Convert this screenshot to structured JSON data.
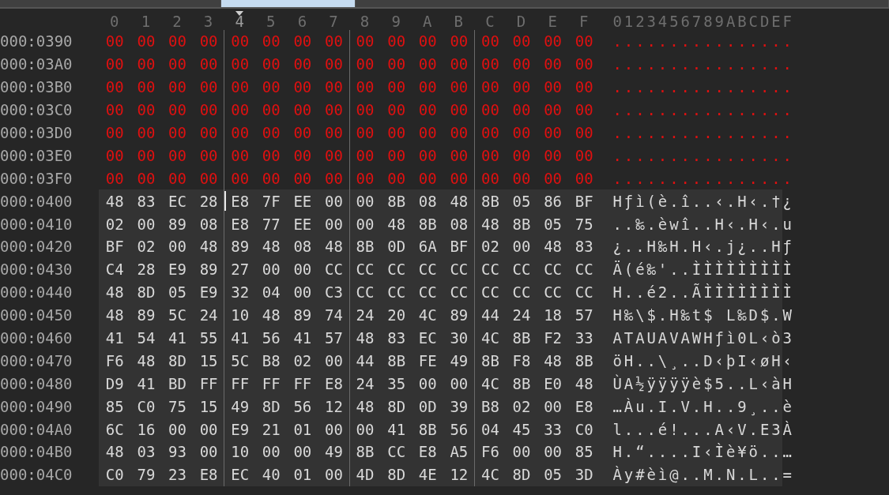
{
  "tab_bar": {
    "tabs": [
      {
        "selected": false
      },
      {
        "selected": true
      },
      {
        "selected": false
      }
    ]
  },
  "columns": [
    {
      "label": "0",
      "selected": false
    },
    {
      "label": "1",
      "selected": false
    },
    {
      "label": "2",
      "selected": false
    },
    {
      "label": "3",
      "selected": false
    },
    {
      "label": "4",
      "selected": true
    },
    {
      "label": "5",
      "selected": false
    },
    {
      "label": "6",
      "selected": false
    },
    {
      "label": "7",
      "selected": false
    },
    {
      "label": "8",
      "selected": false
    },
    {
      "label": "9",
      "selected": false
    },
    {
      "label": "A",
      "selected": false
    },
    {
      "label": "B",
      "selected": false
    },
    {
      "label": "C",
      "selected": false
    },
    {
      "label": "D",
      "selected": false
    },
    {
      "label": "E",
      "selected": false
    },
    {
      "label": "F",
      "selected": false
    }
  ],
  "ascii_header": "0123456789ABCDEF",
  "rows": [
    {
      "address": "000:0390",
      "kind": "zero",
      "cursor": false,
      "bytes": [
        "00",
        "00",
        "00",
        "00",
        "00",
        "00",
        "00",
        "00",
        "00",
        "00",
        "00",
        "00",
        "00",
        "00",
        "00",
        "00"
      ],
      "ascii": "................"
    },
    {
      "address": "000:03A0",
      "kind": "zero",
      "cursor": false,
      "bytes": [
        "00",
        "00",
        "00",
        "00",
        "00",
        "00",
        "00",
        "00",
        "00",
        "00",
        "00",
        "00",
        "00",
        "00",
        "00",
        "00"
      ],
      "ascii": "................"
    },
    {
      "address": "000:03B0",
      "kind": "zero",
      "cursor": false,
      "bytes": [
        "00",
        "00",
        "00",
        "00",
        "00",
        "00",
        "00",
        "00",
        "00",
        "00",
        "00",
        "00",
        "00",
        "00",
        "00",
        "00"
      ],
      "ascii": "................"
    },
    {
      "address": "000:03C0",
      "kind": "zero",
      "cursor": false,
      "bytes": [
        "00",
        "00",
        "00",
        "00",
        "00",
        "00",
        "00",
        "00",
        "00",
        "00",
        "00",
        "00",
        "00",
        "00",
        "00",
        "00"
      ],
      "ascii": "................"
    },
    {
      "address": "000:03D0",
      "kind": "zero",
      "cursor": false,
      "bytes": [
        "00",
        "00",
        "00",
        "00",
        "00",
        "00",
        "00",
        "00",
        "00",
        "00",
        "00",
        "00",
        "00",
        "00",
        "00",
        "00"
      ],
      "ascii": "................"
    },
    {
      "address": "000:03E0",
      "kind": "zero",
      "cursor": false,
      "bytes": [
        "00",
        "00",
        "00",
        "00",
        "00",
        "00",
        "00",
        "00",
        "00",
        "00",
        "00",
        "00",
        "00",
        "00",
        "00",
        "00"
      ],
      "ascii": "................"
    },
    {
      "address": "000:03F0",
      "kind": "zero",
      "cursor": false,
      "bytes": [
        "00",
        "00",
        "00",
        "00",
        "00",
        "00",
        "00",
        "00",
        "00",
        "00",
        "00",
        "00",
        "00",
        "00",
        "00",
        "00"
      ],
      "ascii": "................"
    },
    {
      "address": "000:0400",
      "kind": "data",
      "cursor": true,
      "bytes": [
        "48",
        "83",
        "EC",
        "28",
        "E8",
        "7F",
        "EE",
        "00",
        "00",
        "8B",
        "08",
        "48",
        "8B",
        "05",
        "86",
        "BF"
      ],
      "ascii": "Hƒì(è.î..‹.H‹.†¿"
    },
    {
      "address": "000:0410",
      "kind": "data",
      "cursor": false,
      "bytes": [
        "02",
        "00",
        "89",
        "08",
        "E8",
        "77",
        "EE",
        "00",
        "00",
        "48",
        "8B",
        "08",
        "48",
        "8B",
        "05",
        "75"
      ],
      "ascii": "..‰.èwî..H‹.H‹.u"
    },
    {
      "address": "000:0420",
      "kind": "data",
      "cursor": false,
      "bytes": [
        "BF",
        "02",
        "00",
        "48",
        "89",
        "48",
        "08",
        "48",
        "8B",
        "0D",
        "6A",
        "BF",
        "02",
        "00",
        "48",
        "83"
      ],
      "ascii": "¿..H‰H.H‹.j¿..Hƒ"
    },
    {
      "address": "000:0430",
      "kind": "data",
      "cursor": false,
      "bytes": [
        "C4",
        "28",
        "E9",
        "89",
        "27",
        "00",
        "00",
        "CC",
        "CC",
        "CC",
        "CC",
        "CC",
        "CC",
        "CC",
        "CC",
        "CC"
      ],
      "ascii": "Ä(é‰'..ÌÌÌÌÌÌÌÌÌ"
    },
    {
      "address": "000:0440",
      "kind": "data",
      "cursor": false,
      "bytes": [
        "48",
        "8D",
        "05",
        "E9",
        "32",
        "04",
        "00",
        "C3",
        "CC",
        "CC",
        "CC",
        "CC",
        "CC",
        "CC",
        "CC",
        "CC"
      ],
      "ascii": "H..é2..ÃÌÌÌÌÌÌÌÌ"
    },
    {
      "address": "000:0450",
      "kind": "data",
      "cursor": false,
      "bytes": [
        "48",
        "89",
        "5C",
        "24",
        "10",
        "48",
        "89",
        "74",
        "24",
        "20",
        "4C",
        "89",
        "44",
        "24",
        "18",
        "57"
      ],
      "ascii": "H‰\\$.H‰t$ L‰D$.W"
    },
    {
      "address": "000:0460",
      "kind": "data",
      "cursor": false,
      "bytes": [
        "41",
        "54",
        "41",
        "55",
        "41",
        "56",
        "41",
        "57",
        "48",
        "83",
        "EC",
        "30",
        "4C",
        "8B",
        "F2",
        "33"
      ],
      "ascii": "ATAUAVAWHƒì0L‹ò3"
    },
    {
      "address": "000:0470",
      "kind": "data",
      "cursor": false,
      "bytes": [
        "F6",
        "48",
        "8D",
        "15",
        "5C",
        "B8",
        "02",
        "00",
        "44",
        "8B",
        "FE",
        "49",
        "8B",
        "F8",
        "48",
        "8B"
      ],
      "ascii": "öH..\\¸..D‹þI‹øH‹"
    },
    {
      "address": "000:0480",
      "kind": "data",
      "cursor": false,
      "bytes": [
        "D9",
        "41",
        "BD",
        "FF",
        "FF",
        "FF",
        "FF",
        "E8",
        "24",
        "35",
        "00",
        "00",
        "4C",
        "8B",
        "E0",
        "48"
      ],
      "ascii": "ÙA½ÿÿÿÿè$5..L‹àH"
    },
    {
      "address": "000:0490",
      "kind": "data",
      "cursor": false,
      "bytes": [
        "85",
        "C0",
        "75",
        "15",
        "49",
        "8D",
        "56",
        "12",
        "48",
        "8D",
        "0D",
        "39",
        "B8",
        "02",
        "00",
        "E8"
      ],
      "ascii": "…Àu.I.V.H..9¸..è"
    },
    {
      "address": "000:04A0",
      "kind": "data",
      "cursor": false,
      "bytes": [
        "6C",
        "16",
        "00",
        "00",
        "E9",
        "21",
        "01",
        "00",
        "00",
        "41",
        "8B",
        "56",
        "04",
        "45",
        "33",
        "C0"
      ],
      "ascii": "l...é!...A‹V.E3À"
    },
    {
      "address": "000:04B0",
      "kind": "data",
      "cursor": false,
      "bytes": [
        "48",
        "03",
        "93",
        "00",
        "10",
        "00",
        "00",
        "49",
        "8B",
        "CC",
        "E8",
        "A5",
        "F6",
        "00",
        "00",
        "85"
      ],
      "ascii": "H.“....I‹Ìè¥ö..…"
    },
    {
      "address": "000:04C0",
      "kind": "data",
      "cursor": false,
      "bytes": [
        "C0",
        "79",
        "23",
        "E8",
        "EC",
        "40",
        "01",
        "00",
        "4D",
        "8D",
        "4E",
        "12",
        "4C",
        "8D",
        "05",
        "3D"
      ],
      "ascii": "Ày#èì@..M.N.L..="
    }
  ]
}
